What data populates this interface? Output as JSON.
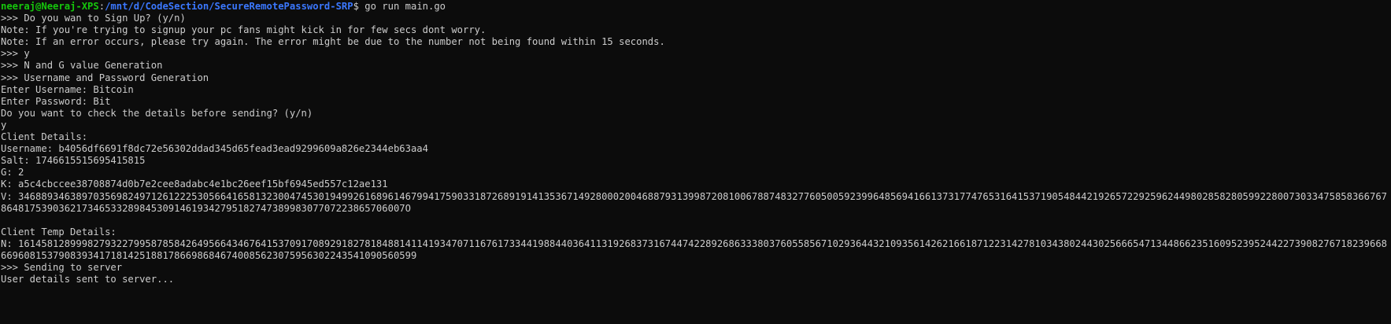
{
  "theme": {
    "background": "#0c0c0c",
    "foreground": "#cccccc",
    "prompt_user_color": "#16c60c",
    "prompt_path_color": "#3b78ff"
  },
  "prompt": {
    "user_host": "neeraj@Neeraj-XPS",
    "separator": ":",
    "path": "/mnt/d/CodeSection/SecureRemotePassword-SRP",
    "symbol": "$",
    "command": " go run main.go"
  },
  "output": {
    "l01": ">>> Do you wan to Sign Up? (y/n)",
    "l02": "Note: If you're trying to signup your pc fans might kick in for few secs dont worry.",
    "l03": "Note: If an error occurs, please try again. The error might be due to the number not being found within 15 seconds.",
    "l04": ">>> y",
    "l05": ">>> N and G value Generation",
    "l06": ">>> Username and Password Generation",
    "l07": "Enter Username: Bitcoin",
    "l08": "Enter Password: Bit",
    "l09": "Do you want to check the details before sending? (y/n)",
    "l10": "y",
    "l11": "Client Details:",
    "l12": "Username: b4056df6691f8dc72e56302ddad345d65fead3ead9299609a826e2344eb63aa4",
    "l13": "Salt: 1746615515695415815",
    "l14": "G: 2",
    "l15": "K: a5c4cbccee38708874d0b7e2cee8adabc4e1bc26eef15bf6945ed557c12ae131",
    "l16": "V: 3468893463897035698249712612225305664165813230047453019499261689614679941759033187268919141353671492800020046887931399872081006788748327760500592399648569416613731774765316415371905484421926572292596244980285828059922800730334758583667678648175390362173465332898453091461934279518274738998307707223865706007O",
    "l17": "",
    "l18": "Client Temp Details:",
    "l19": "N: 161458128999827932279958785842649566434676415370917089291827818488141141934707116761733441988440364113192683731674474228926863338037605585671029364432109356142621661871223142781034380244302566654713448662351609523952442273908276718239668669608153790839341718142518817866986846740085623075956302243541090560599",
    "l20": ">>> Sending to server",
    "l21": "User details sent to server..."
  }
}
